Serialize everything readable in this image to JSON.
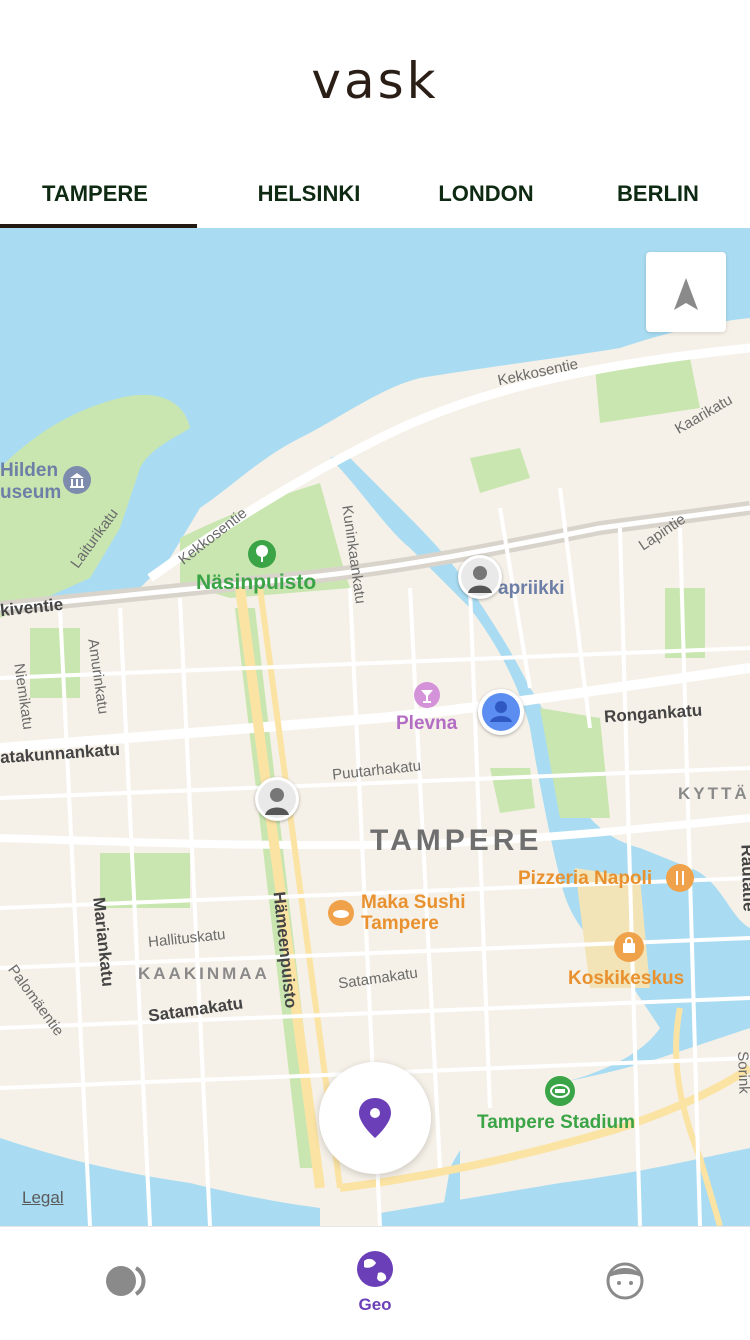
{
  "app": {
    "logo_text": "vask"
  },
  "tabs": [
    {
      "label": "TAMPERE",
      "active": true
    },
    {
      "label": "HELSINKI",
      "active": false
    },
    {
      "label": "LONDON",
      "active": false
    },
    {
      "label": "BERLIN",
      "active": false
    }
  ],
  "map": {
    "pois": {
      "hilden_museum_line1": "Hilden",
      "hilden_museum_line2": "useum",
      "nasinpuisto": "Näsinpuisto",
      "vapriikki": "apriikki",
      "plevna": "Plevna",
      "maka_sushi_line1": "Maka Sushi",
      "maka_sushi_line2": "Tampere",
      "pizzeria_napoli": "Pizzeria Napoli",
      "koskikeskus": "Koskikeskus",
      "tampere_stadium": "Tampere Stadium"
    },
    "city_label": "TAMPERE",
    "districts": {
      "kaakinmaa": "KAAKINMAA",
      "kyttala": "KYTTÄL"
    },
    "streets": {
      "kekkosentie_top": "Kekkosentie",
      "kekkosentie_left": "Kekkosentie",
      "kaarikatu": "Kaarikatu",
      "lapintie": "Lapintie",
      "laiturikatu": "Laiturikatu",
      "kuninkaankatu": "Kuninkaankatu",
      "kiventie": "kiventie",
      "amurinkatu": "Amurinkatu",
      "niemikatu": "Niemikatu",
      "satakunnankatu": "atakunnankatu",
      "puutarhakatu": "Puutarhakatu",
      "rongankatu": "Rongankatu",
      "mariankatu": "Mariankatu",
      "hameenpuisto": "Hämeenpuisto",
      "hallituskatu": "Hallituskatu",
      "satamakatu_left": "Satamakatu",
      "satamakatu_right": "Satamakatu",
      "palomaentie": "Palomäentie",
      "rautatie": "Rautatie",
      "sorinkatu": "Sorink"
    },
    "legal_label": "Legal"
  },
  "nav": [
    {
      "label": "",
      "icon": "toggle-moon-icon",
      "active": false
    },
    {
      "label": "Geo",
      "icon": "globe-icon",
      "active": true
    },
    {
      "label": "",
      "icon": "face-icon",
      "active": false
    }
  ],
  "colors": {
    "water": "#a9dcf2",
    "land": "#f6f1e8",
    "park": "#c9e6b0",
    "accent": "#6b3fb8",
    "tab_text": "#0e2a12"
  }
}
